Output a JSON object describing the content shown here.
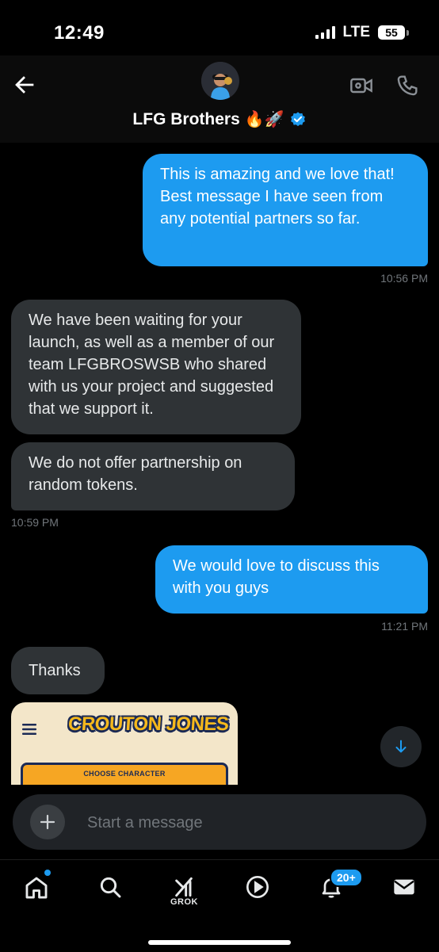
{
  "status_bar": {
    "time": "12:49",
    "network": "LTE",
    "battery": "55"
  },
  "header": {
    "name": "LFG Brothers",
    "name_emoji": "🔥🚀",
    "verified": true
  },
  "messages": [
    {
      "direction": "out",
      "text": "This is amazing and we love that! Best message I have seen from any potential partners so far.",
      "time": "10:56 PM"
    },
    {
      "direction": "in",
      "text": "We have been waiting for your launch, as well as a member of our team LFGBROSWSB who shared with us your project and suggested that we support it."
    },
    {
      "direction": "in",
      "text": "We do not offer partnership on random tokens.",
      "time": "10:59 PM"
    },
    {
      "direction": "out",
      "text": "We would love to discuss this with you guys",
      "time": "11:21 PM"
    },
    {
      "direction": "in",
      "text": "Thanks"
    }
  ],
  "preview_card": {
    "title": "CROUTON JONES",
    "panel_label": "CHOOSE CHARACTER"
  },
  "composer": {
    "placeholder": "Start a message"
  },
  "nav": {
    "grok_label": "GROK",
    "notifications_badge": "20+"
  },
  "colors": {
    "accent": "#1d9bf0",
    "incoming_bubble": "#2f3336",
    "background": "#000000"
  }
}
